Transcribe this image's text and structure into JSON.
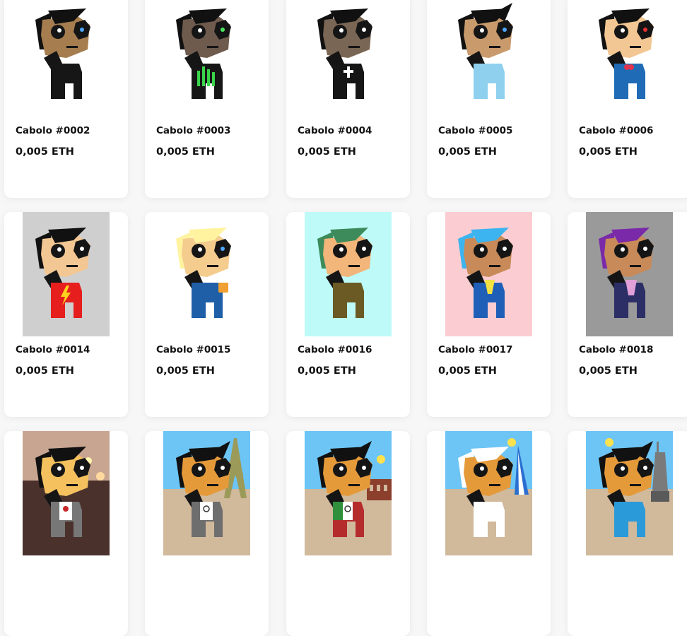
{
  "items": [
    {
      "name": "Cabolo #0002",
      "price": "0,005 ETH",
      "bg": "",
      "skin": "#a57d4f",
      "hair": "#111111",
      "body": "#161616",
      "eye": "#4da6ff",
      "accessory": "none",
      "scene": "none"
    },
    {
      "name": "Cabolo #0003",
      "price": "0,005 ETH",
      "bg": "",
      "skin": "#6e5b4e",
      "hair": "#111111",
      "body": "#161616",
      "eye": "#48e65c",
      "accessory": "green-bars",
      "scene": "none"
    },
    {
      "name": "Cabolo #0004",
      "price": "0,005 ETH",
      "bg": "",
      "skin": "#7a6654",
      "hair": "#111111",
      "body": "#161616",
      "eye": "#ffffff",
      "accessory": "cross",
      "scene": "none"
    },
    {
      "name": "Cabolo #0005",
      "price": "0,005 ETH",
      "bg": "",
      "skin": "#c99a6b",
      "hair": "#111111",
      "body": "#8fd0ef",
      "eye": "#4da6ff",
      "accessory": "none",
      "scene": "none"
    },
    {
      "name": "Cabolo #0006",
      "price": "0,005 ETH",
      "bg": "",
      "skin": "#f3c793",
      "hair": "#111111",
      "body": "#1f6bb5",
      "eye": "#e63232",
      "accessory": "heart",
      "scene": "none"
    },
    {
      "name": "Cabolo #0014",
      "price": "0,005 ETH",
      "bg": "#cfcfcf",
      "skin": "#f3c793",
      "hair": "#111111",
      "body": "#e61e1e",
      "eye": "#ffffff",
      "accessory": "lightning",
      "scene": "none"
    },
    {
      "name": "Cabolo #0015",
      "price": "0,005 ETH",
      "bg": "",
      "skin": "#f4cc8e",
      "hair": "#fff3a0",
      "body": "#1e5fa8",
      "eye": "#4da6ff",
      "accessory": "beer",
      "scene": "none"
    },
    {
      "name": "Cabolo #0016",
      "price": "0,005 ETH",
      "bg": "#bdfaf8",
      "skin": "#f2b57a",
      "hair": "#3d8a5a",
      "body": "#6b5a24",
      "eye": "#ffffff",
      "accessory": "none",
      "scene": "none"
    },
    {
      "name": "Cabolo #0017",
      "price": "0,005 ETH",
      "bg": "#fbcdd2",
      "skin": "#c88a58",
      "hair": "#3cb4f0",
      "body": "#1f5fb8",
      "eye": "#ffffff",
      "accessory": "yellow-tie",
      "scene": "none"
    },
    {
      "name": "Cabolo #0018",
      "price": "0,005 ETH",
      "bg": "#9a9a9a",
      "skin": "#c88a58",
      "hair": "#7a2aa8",
      "body": "#2b2f66",
      "eye": "#ffffff",
      "accessory": "pink-tie",
      "scene": "none"
    },
    {
      "name": "",
      "price": "",
      "bg": "#4a312c",
      "skin": "#f4c15e",
      "hair": "#111111",
      "body": "#777777",
      "eye": "#ffffff",
      "accessory": "rebel",
      "scene": "room"
    },
    {
      "name": "",
      "price": "",
      "bg": "#d1b99c",
      "skin": "#e59a3a",
      "hair": "#111111",
      "body": "#6e6e6e",
      "eye": "#ffffff",
      "accessory": "gucci",
      "scene": "eiffel"
    },
    {
      "name": "",
      "price": "",
      "bg": "#d1b99c",
      "skin": "#e59a3a",
      "hair": "#111111",
      "body": "#b52c2c",
      "eye": "#ffffff",
      "accessory": "italy",
      "scene": "colosseum"
    },
    {
      "name": "",
      "price": "",
      "bg": "#d1b99c",
      "skin": "#e59a3a",
      "hair": "#ffffff",
      "body": "#ffffff",
      "eye": "#ffffff",
      "accessory": "none",
      "scene": "burj"
    },
    {
      "name": "",
      "price": "",
      "bg": "#d1b99c",
      "skin": "#e59a3a",
      "hair": "#111111",
      "body": "#2a9ad8",
      "eye": "#ffffff",
      "accessory": "none",
      "scene": "liberty"
    }
  ]
}
